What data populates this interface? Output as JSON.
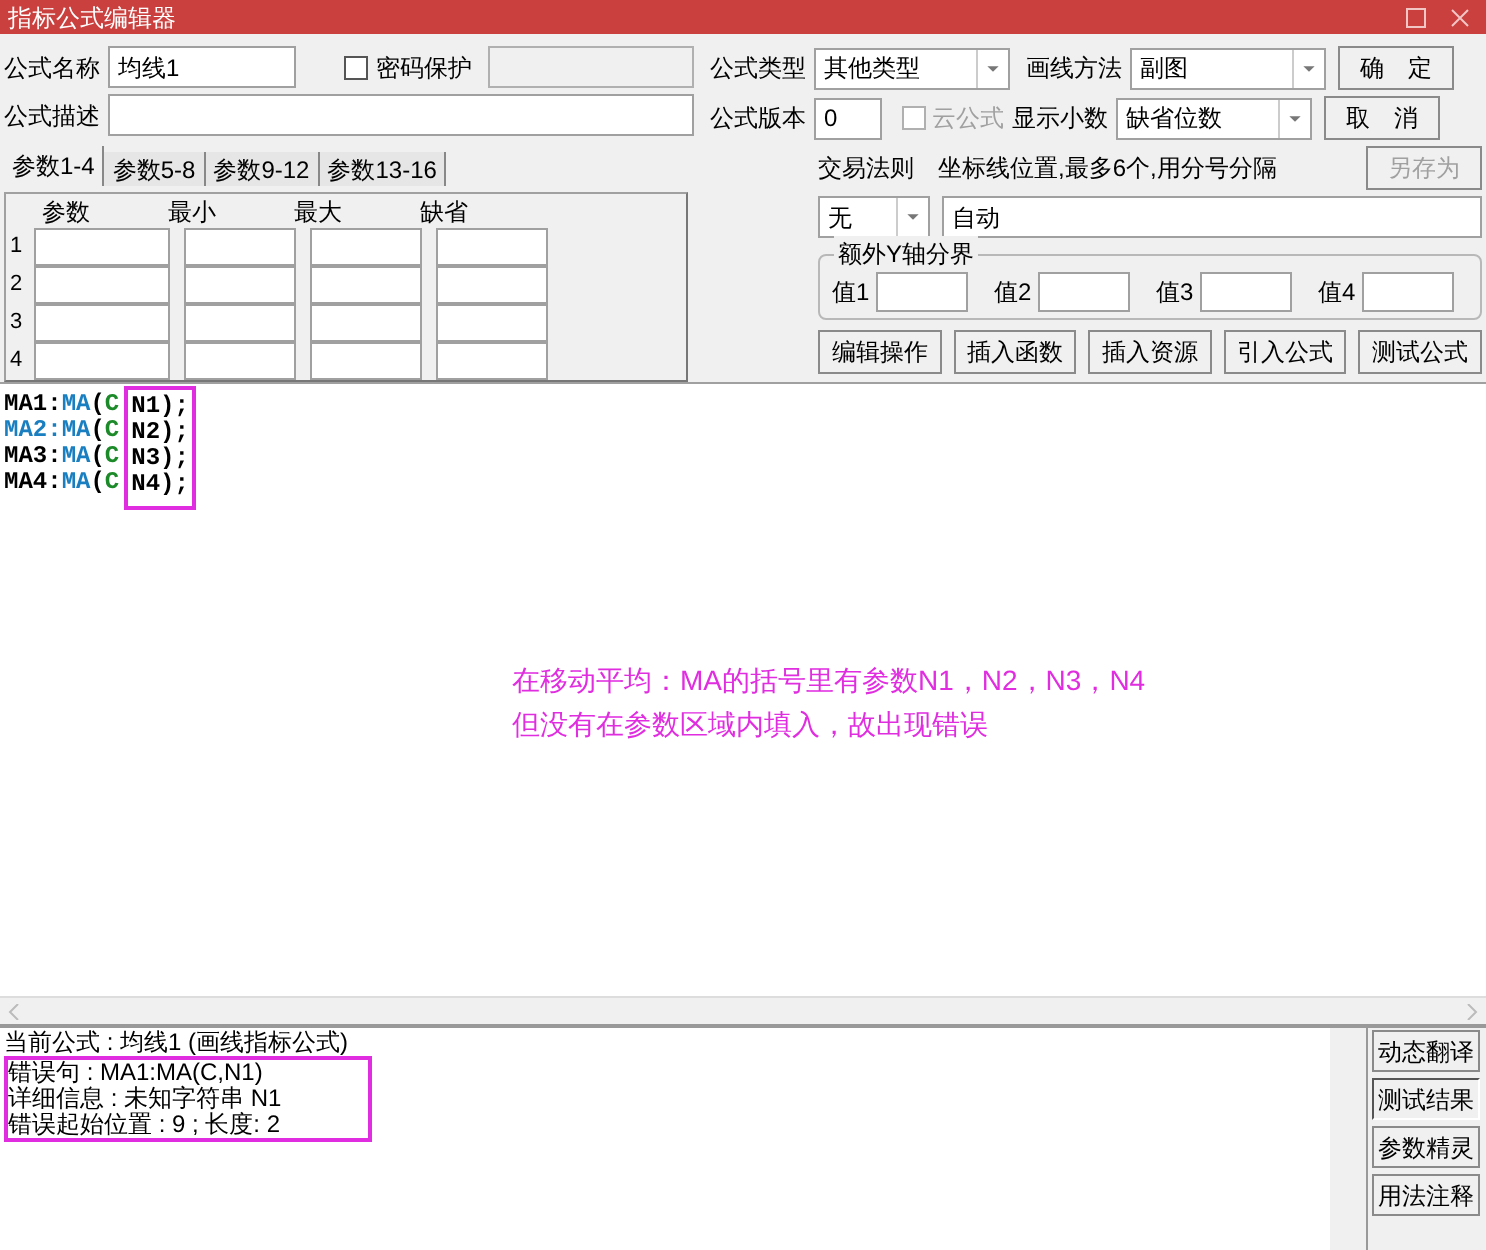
{
  "title": "指标公式编辑器",
  "form": {
    "name_label": "公式名称",
    "name_value": "均线1",
    "password": {
      "label": "密码保护",
      "checked": false
    },
    "description_label": "公式描述",
    "type_label": "公式类型",
    "type_value": "其他类型",
    "draw_label": "画线方法",
    "draw_value": "副图",
    "version_label": "公式版本",
    "version_value": "0",
    "cloud": {
      "label": "云公式",
      "checked": false,
      "disabled": true
    },
    "decimals_label": "显示小数",
    "decimals_value": "缺省位数",
    "rule_label": "交易法则",
    "rule_value": "无",
    "axis_label": "坐标线位置,最多6个,用分号分隔",
    "axis_value": "自动"
  },
  "side_buttons": [
    {
      "label": "确　定",
      "disabled": false
    },
    {
      "label": "取　消",
      "disabled": false
    },
    {
      "label": "另存为",
      "disabled": true
    }
  ],
  "param_tabs": [
    {
      "label": "参数1-4",
      "selected": true
    },
    {
      "label": "参数5-8",
      "selected": false
    },
    {
      "label": "参数9-12",
      "selected": false
    },
    {
      "label": "参数13-16",
      "selected": false
    }
  ],
  "param_columns": [
    "参数",
    "最小",
    "最大",
    "缺省"
  ],
  "param_rows": [
    "1",
    "2",
    "3",
    "4"
  ],
  "y_axis": {
    "title": "额外Y轴分界",
    "labels": [
      "值1",
      "值2",
      "值3",
      "值4"
    ]
  },
  "action_buttons": [
    "编辑操作",
    "插入函数",
    "插入资源",
    "引入公式",
    "测试公式"
  ],
  "code_lines": [
    {
      "tokens": [
        {
          "text": "MA1:",
          "color": "#000000",
          "boxed": false
        },
        {
          "text": "MA",
          "color": "#1a7fc0",
          "boxed": false
        },
        {
          "text": "(",
          "color": "#000000",
          "boxed": false
        },
        {
          "text": "C",
          "color": "#1d8a2a",
          "boxed": false
        },
        {
          "text": "N1);",
          "color": "#000000",
          "boxed": true
        }
      ]
    },
    {
      "tokens": [
        {
          "text": "MA2:",
          "color": "#1a7fc0",
          "boxed": false
        },
        {
          "text": "MA",
          "color": "#1a7fc0",
          "boxed": false
        },
        {
          "text": "(",
          "color": "#000000",
          "boxed": false
        },
        {
          "text": "C",
          "color": "#1d8a2a",
          "boxed": false
        },
        {
          "text": "N2);",
          "color": "#000000",
          "boxed": true
        }
      ]
    },
    {
      "tokens": [
        {
          "text": "MA3:",
          "color": "#000000",
          "boxed": false
        },
        {
          "text": "MA",
          "color": "#1a7fc0",
          "boxed": false
        },
        {
          "text": "(",
          "color": "#000000",
          "boxed": false
        },
        {
          "text": "C",
          "color": "#1d8a2a",
          "boxed": false
        },
        {
          "text": "N3);",
          "color": "#000000",
          "boxed": true
        }
      ]
    },
    {
      "tokens": [
        {
          "text": "MA4:",
          "color": "#000000",
          "boxed": false
        },
        {
          "text": "MA",
          "color": "#1a7fc0",
          "boxed": false
        },
        {
          "text": "(",
          "color": "#000000",
          "boxed": false
        },
        {
          "text": "C",
          "color": "#1d8a2a",
          "boxed": false
        },
        {
          "text": "N4);",
          "color": "#000000",
          "boxed": true
        }
      ]
    }
  ],
  "annotation": [
    "在移动平均：MA的括号里有参数N1，N2，N3，N4",
    "但没有在参数区域内填入，故出现错误"
  ],
  "output_lines": [
    {
      "text": "当前公式 : 均线1 (画线指标公式)",
      "highlighted": false
    },
    {
      "text": "错误句 : MA1:MA(C,N1)",
      "highlighted": true
    },
    {
      "text": "详细信息 : 未知字符串 N1",
      "highlighted": true
    },
    {
      "text": "错误起始位置 : 9 ; 长度: 2",
      "highlighted": true
    }
  ],
  "output_buttons": [
    {
      "label": "动态翻译",
      "selected": false
    },
    {
      "label": "测试结果",
      "selected": true
    },
    {
      "label": "参数精灵",
      "selected": false
    },
    {
      "label": "用法注释",
      "selected": false
    }
  ]
}
